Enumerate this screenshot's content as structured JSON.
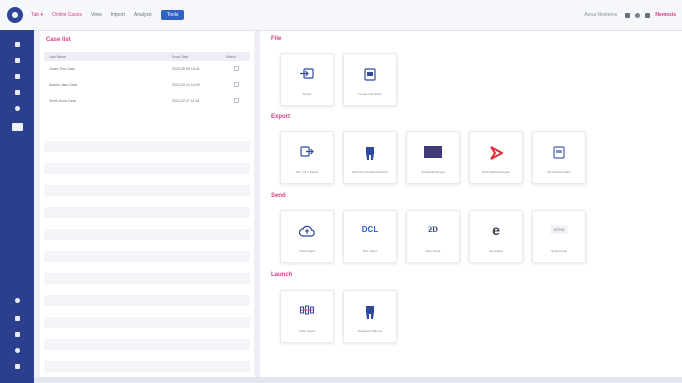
{
  "topbar": {
    "tabs": [
      {
        "label": "Tab ▾",
        "style": "pink"
      },
      {
        "label": "Online Cases",
        "style": "pink"
      },
      {
        "label": "View",
        "style": "plain"
      },
      {
        "label": "Import",
        "style": "plain"
      },
      {
        "label": "Analyze",
        "style": "plain"
      },
      {
        "label": "Tools",
        "style": "active"
      }
    ],
    "user": "Anna Nesterov",
    "brand": "Nemesis"
  },
  "cases": {
    "title": "Case list",
    "columns": [
      "Last Name",
      "Scan Date",
      "Select"
    ],
    "rows": [
      {
        "name": "Jones Tom Case",
        "date": "2023-05-08 16:41"
      },
      {
        "name": "Adams Jack Case",
        "date": "2023-03-10 14:09"
      },
      {
        "name": "Smith Anna Case",
        "date": "2023-02-17 11:34"
      }
    ]
  },
  "sections": {
    "file": {
      "title": "File",
      "tiles": [
        {
          "label": "Import",
          "icon": "import-icon"
        },
        {
          "label": "Create Lab Order",
          "icon": "lab-order-icon"
        }
      ]
    },
    "export": {
      "title": "Export",
      "tiles": [
        {
          "label": "STL / PLY Export",
          "icon": "stl-export-icon"
        },
        {
          "label": "Planning Treatment Export",
          "icon": "planning-export-icon"
        },
        {
          "label": "SmartCAD Export",
          "icon": "smartcad-icon"
        },
        {
          "label": "Ortho Planner Export",
          "icon": "planner-icon"
        },
        {
          "label": "Send Data Folder",
          "icon": "data-folder-icon"
        }
      ]
    },
    "send": {
      "title": "Send",
      "tiles": [
        {
          "label": "Cloud Send",
          "icon": "cloud-icon"
        },
        {
          "label": "DCL Send",
          "icon": "dcl-icon",
          "text": "DCL"
        },
        {
          "label": "Scan Send",
          "icon": "scan-send-icon",
          "text": "ƻD"
        },
        {
          "label": "Send Easy",
          "icon": "e-icon",
          "text": "e"
        },
        {
          "label": "Send Portal",
          "icon": "portal-icon",
          "text": "SEND"
        }
      ]
    },
    "launch": {
      "title": "Launch",
      "tiles": [
        {
          "label": "Ortho Studio",
          "icon": "ortho-studio-icon"
        },
        {
          "label": "Treatment Planner",
          "icon": "treatment-planner-icon"
        }
      ]
    }
  },
  "colors": {
    "accent": "#d63c86",
    "rail": "#2c3f8f",
    "active_tab": "#2f62c6"
  }
}
